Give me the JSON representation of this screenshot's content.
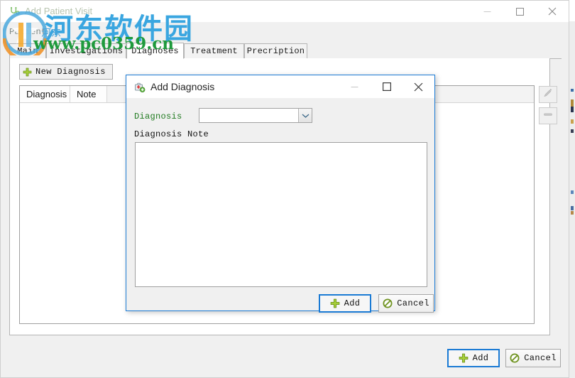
{
  "window": {
    "title": "Add Patient Visit",
    "icon": "stethoscope-icon",
    "minimize_label": "—",
    "maximize_label": "□",
    "close_label": "✕"
  },
  "patient": {
    "label": "Patient"
  },
  "tabs": [
    {
      "label": "Main",
      "selected": false
    },
    {
      "label": "Investigations",
      "selected": false
    },
    {
      "label": "Diagnoses",
      "selected": true
    },
    {
      "label": "Treatment",
      "selected": false
    },
    {
      "label": "Precription",
      "selected": false
    }
  ],
  "content": {
    "new_diagnosis_label": "New Diagnosis",
    "new_diagnosis_icon": "green-plus-icon",
    "grid": {
      "columns": [
        "Diagnosis",
        "Note"
      ],
      "rows": []
    },
    "side_buttons": [
      {
        "name": "edit-button",
        "icon": "pencil-icon",
        "enabled": false
      },
      {
        "name": "delete-button",
        "icon": "minus-icon",
        "enabled": false
      }
    ]
  },
  "footer": {
    "add_label": "Add",
    "add_icon": "green-plus-icon",
    "cancel_label": "Cancel",
    "cancel_icon": "no-entry-icon"
  },
  "dialog": {
    "title": "Add Diagnosis",
    "icon": "medical-kit-icon",
    "minimize_label": "—",
    "maximize_label": "□",
    "close_label": "✕",
    "diagnosis_label": "Diagnosis",
    "diagnosis_value": "",
    "diagnosis_options": [],
    "note_label": "Diagnosis Note",
    "note_value": "",
    "add_label": "Add",
    "add_icon": "green-plus-icon",
    "cancel_label": "Cancel",
    "cancel_icon": "no-entry-icon"
  },
  "watermark": {
    "chinese": "河东软件园",
    "chinese_small": "河东",
    "url": "www.pc0359.cn"
  },
  "colors": {
    "accent_blue": "#1a7ad4",
    "required_green": "#1f7a1f",
    "plus_green": "#8cc63f",
    "watermark_blue": "#3aa6e0",
    "watermark_green": "#1e9a3c"
  }
}
